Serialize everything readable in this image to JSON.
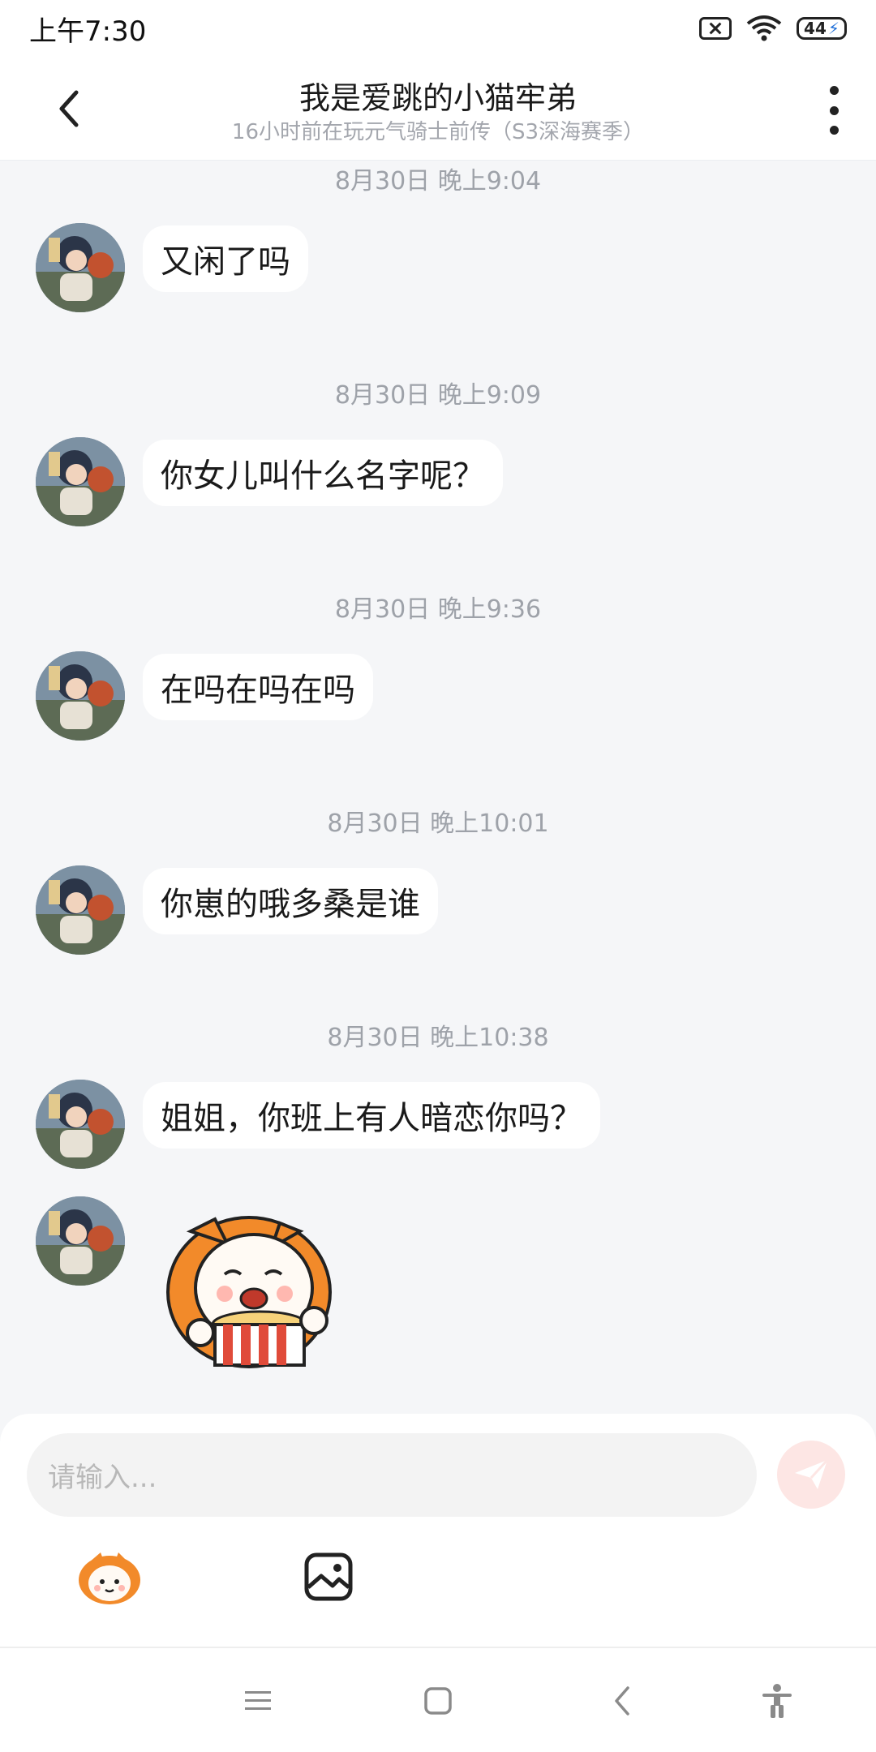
{
  "status_bar": {
    "time": "上午7:30",
    "icons": [
      "sim-off-icon",
      "wifi-icon",
      "battery-icon"
    ],
    "battery_level": "44"
  },
  "header": {
    "title": "我是爱跳的小猫牢弟",
    "subtitle": "16小时前在玩元气骑士前传（S3深海赛季）",
    "back_icon": "chevron-left-icon",
    "more_icon": "more-vertical-icon"
  },
  "messages": [
    {
      "timestamp": "8月30日 晚上9:04",
      "text": "又闲了吗"
    },
    {
      "timestamp": "8月30日 晚上9:09",
      "text": "你女儿叫什么名字呢？"
    },
    {
      "timestamp": "8月30日 晚上9:36",
      "text": "在吗在吗在吗"
    },
    {
      "timestamp": "8月30日 晚上10:01",
      "text": "你崽的哦多桑是谁"
    },
    {
      "timestamp": "8月30日 晚上10:38",
      "text": "姐姐，你班上有人暗恋你吗？"
    }
  ],
  "sticker": {
    "icon": "popcorn-sticker-icon"
  },
  "input": {
    "placeholder": "请输入...",
    "send_icon": "send-icon",
    "emoji_icon": "emoji-icon",
    "image_icon": "image-icon"
  },
  "nav_bar": {
    "icons": [
      "menu-icon",
      "home-icon",
      "back-icon",
      "accessibility-icon"
    ]
  },
  "colors": {
    "background": "#f5f6f8",
    "bubble": "#ffffff",
    "timestamp": "#9ea2a9",
    "send_button": "#fde6e4",
    "send_arrow": "#ffffff"
  }
}
